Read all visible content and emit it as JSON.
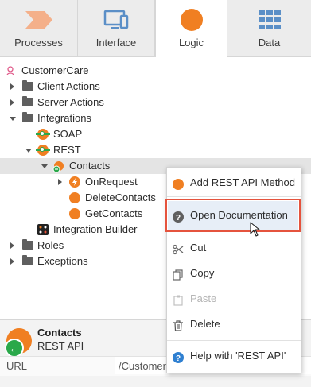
{
  "tabs": [
    {
      "label": "Processes",
      "icon": "processes-chevron-icon"
    },
    {
      "label": "Interface",
      "icon": "interface-monitor-icon"
    },
    {
      "label": "Logic",
      "icon": "logic-circle-icon"
    },
    {
      "label": "Data",
      "icon": "data-grid-icon"
    }
  ],
  "tree": {
    "module": "CustomerCare",
    "client_actions": "Client Actions",
    "server_actions": "Server Actions",
    "integrations": "Integrations",
    "soap": "SOAP",
    "rest": "REST",
    "contacts": "Contacts",
    "on_request": "OnRequest",
    "delete_contacts": "DeleteContacts",
    "get_contacts": "GetContacts",
    "integration_builder": "Integration Builder",
    "roles": "Roles",
    "exceptions": "Exceptions"
  },
  "properties": {
    "name": "Contacts",
    "type": "REST API",
    "url_label": "URL",
    "url_value": "/Customer"
  },
  "context_menu": {
    "add_method": "Add REST API Method",
    "open_documentation": "Open Documentation",
    "cut": "Cut",
    "copy": "Copy",
    "paste": "Paste",
    "delete": "Delete",
    "help": "Help with 'REST API'"
  },
  "colors": {
    "accent_orange": "#f07f22",
    "accent_green": "#2aa84a",
    "tab_icon_blue": "#5b8fc7",
    "help_blue": "#2f80d1",
    "highlight_border": "#e5533d"
  }
}
